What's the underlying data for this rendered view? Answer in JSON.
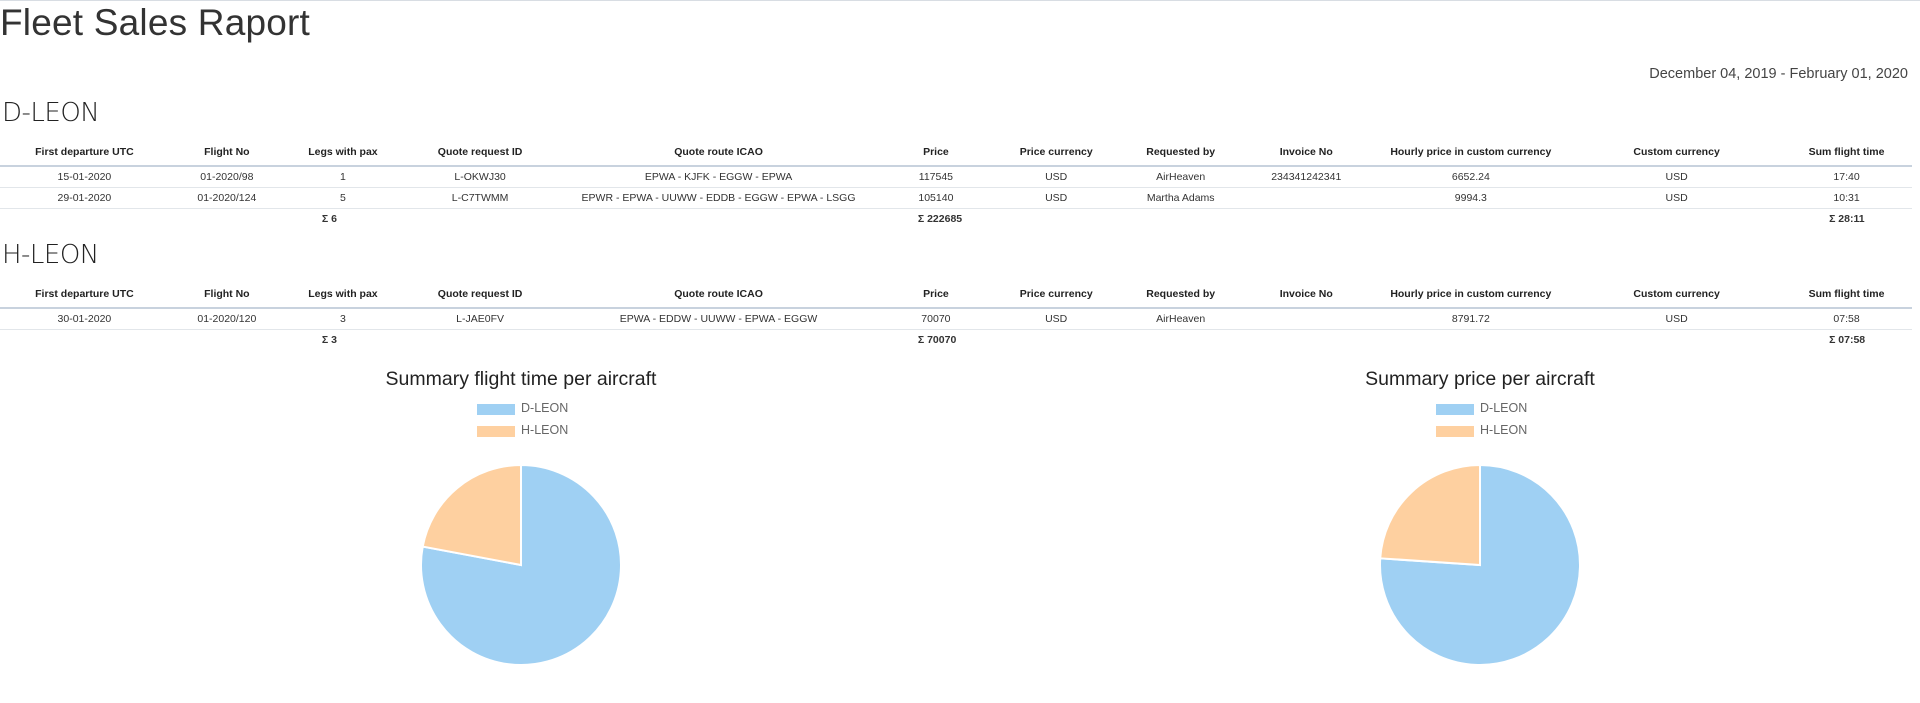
{
  "report": {
    "title": "Fleet Sales Raport",
    "date_range": "December 04, 2019 - February 01, 2020"
  },
  "columns": [
    "First departure UTC",
    "Flight No",
    "Legs with pax",
    "Quote request ID",
    "Quote route ICAO",
    "Price",
    "Price currency",
    "Requested by",
    "Invoice No",
    "Hourly price in custom currency",
    "Custom currency",
    "Sum flight time"
  ],
  "sections": [
    {
      "aircraft": "D-LEON",
      "rows": [
        [
          "15-01-2020",
          "01-2020/98",
          "1",
          "L-OKWJ30",
          "EPWA - KJFK - EGGW - EPWA",
          "117545",
          "USD",
          "AirHeaven",
          "234341242341",
          "6652.24",
          "USD",
          "17:40"
        ],
        [
          "29-01-2020",
          "01-2020/124",
          "5",
          "L-C7TWMM",
          "EPWR - EPWA - UUWW - EDDB - EGGW - EPWA - LSGG",
          "105140",
          "USD",
          "Martha Adams",
          "",
          "9994.3",
          "USD",
          "10:31"
        ]
      ],
      "sum_legs": "Σ 6",
      "sum_price": "Σ 222685",
      "sum_time": "Σ 28:11"
    },
    {
      "aircraft": "H-LEON",
      "rows": [
        [
          "30-01-2020",
          "01-2020/120",
          "3",
          "L-JAE0FV",
          "EPWA - EDDW - UUWW - EPWA - EGGW",
          "70070",
          "USD",
          "AirHeaven",
          "",
          "8791.72",
          "USD",
          "07:58"
        ]
      ],
      "sum_legs": "Σ 3",
      "sum_price": "Σ 70070",
      "sum_time": "Σ 07:58"
    }
  ],
  "chart_data": [
    {
      "type": "pie",
      "title": "Summary flight time per aircraft",
      "categories": [
        "D-LEON",
        "H-LEON"
      ],
      "values": [
        28.18,
        7.97
      ],
      "colors": [
        "#9fd0f3",
        "#fed0a0"
      ],
      "legend": "top"
    },
    {
      "type": "pie",
      "title": "Summary price per aircraft",
      "categories": [
        "D-LEON",
        "H-LEON"
      ],
      "values": [
        222685,
        70070
      ],
      "colors": [
        "#9fd0f3",
        "#fed0a0"
      ],
      "legend": "top"
    }
  ]
}
